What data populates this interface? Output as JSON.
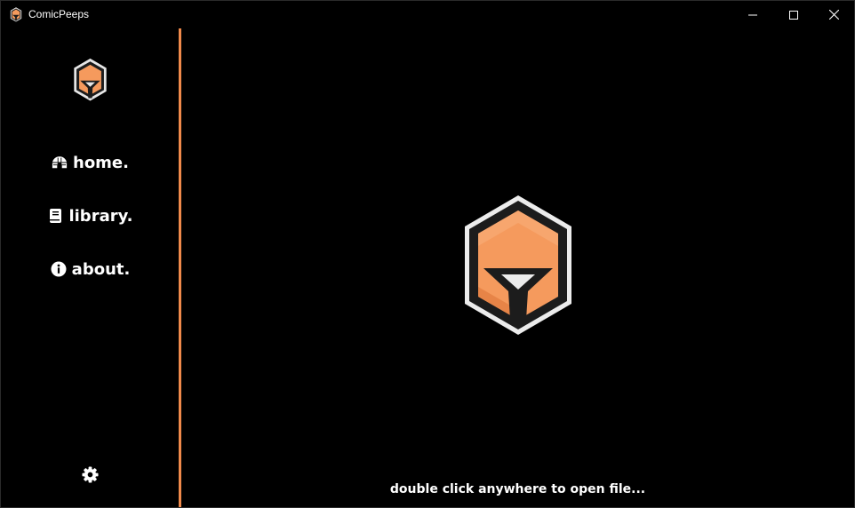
{
  "window": {
    "title": "ComicPeeps",
    "icons": {
      "app": "comicpeeps-logo-icon",
      "minimize": "minimize-icon",
      "maximize": "maximize-icon",
      "close": "close-icon"
    }
  },
  "sidebar": {
    "logo": "comicpeeps-logo-icon",
    "items": [
      {
        "label": "home.",
        "icon": "igloo-icon"
      },
      {
        "label": "library.",
        "icon": "book-icon"
      },
      {
        "label": "about.",
        "icon": "info-icon"
      }
    ],
    "settings_icon": "gear-icon"
  },
  "main": {
    "logo": "comicpeeps-logo-icon",
    "hint": "double click anywhere to open file..."
  },
  "colors": {
    "accent": "#f08a4b",
    "logo_orange": "#f59a5d",
    "logo_dark": "#1c1c1c",
    "logo_outline": "#ececec",
    "background": "#000000"
  }
}
